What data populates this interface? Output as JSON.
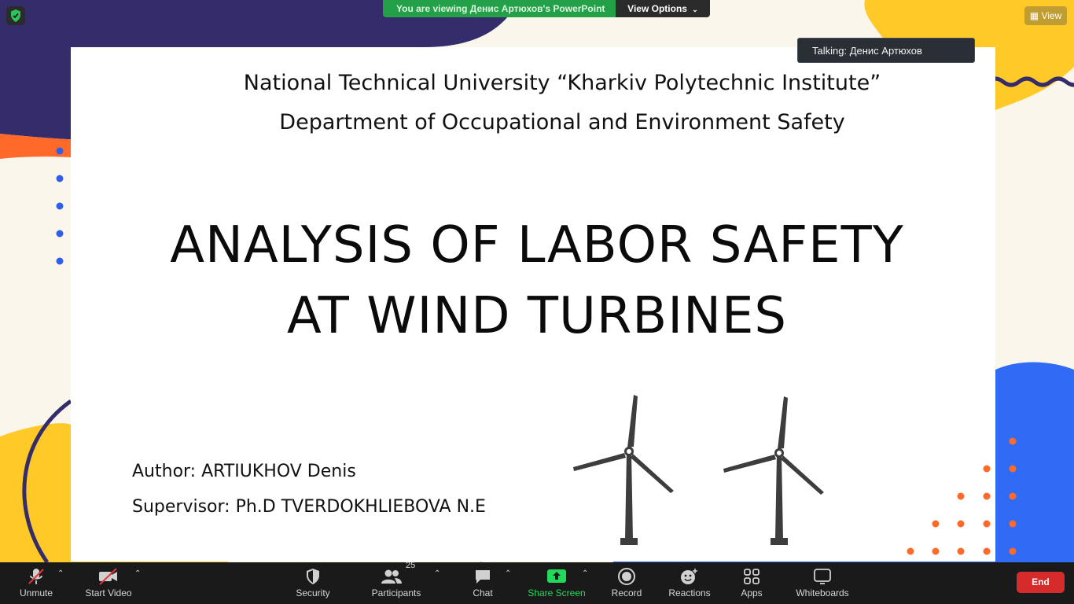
{
  "banner": {
    "viewing_text": "You are viewing Денис Артюхов's PowerPoint",
    "view_options_label": "View Options",
    "view_button_label": "View"
  },
  "talking_indicator": "Talking: Денис Артюхов",
  "slide": {
    "line1": "National Technical University “Kharkiv Polytechnic Institute”",
    "line2": "Department of Occupational and Environment Safety",
    "title_line1": "ANALYSIS OF LABOR SAFETY",
    "title_line2": "AT WIND TURBINES",
    "author": "Author: ARTIUKHOV Denis",
    "supervisor": "Supervisor:  Ph.D TVERDOKHLIEBOVA N.E"
  },
  "toolbar": {
    "unmute": "Unmute",
    "start_video": "Start Video",
    "security": "Security",
    "participants": "Participants",
    "participants_count": "25",
    "chat": "Chat",
    "share_screen": "Share Screen",
    "record": "Record",
    "reactions": "Reactions",
    "apps": "Apps",
    "whiteboards": "Whiteboards",
    "end": "End"
  },
  "colors": {
    "banner_green": "#24a148",
    "share_green": "#23d959",
    "end_red": "#d52b2b",
    "navy_blob": "#352c6b",
    "orange_blob": "#ff6a2b",
    "yellow_blob": "#ffca28",
    "blue_blob": "#2f6bf5",
    "dot_blue": "#2f5fe8",
    "dot_orange": "#ff6a2b"
  },
  "icons": [
    "shield-icon",
    "mic-muted-icon",
    "video-muted-icon",
    "security-icon",
    "participants-icon",
    "chat-icon",
    "share-screen-icon",
    "record-icon",
    "reactions-icon",
    "apps-icon",
    "whiteboard-icon",
    "chevron-up-icon",
    "chevron-down-icon",
    "wind-turbine-icon"
  ]
}
